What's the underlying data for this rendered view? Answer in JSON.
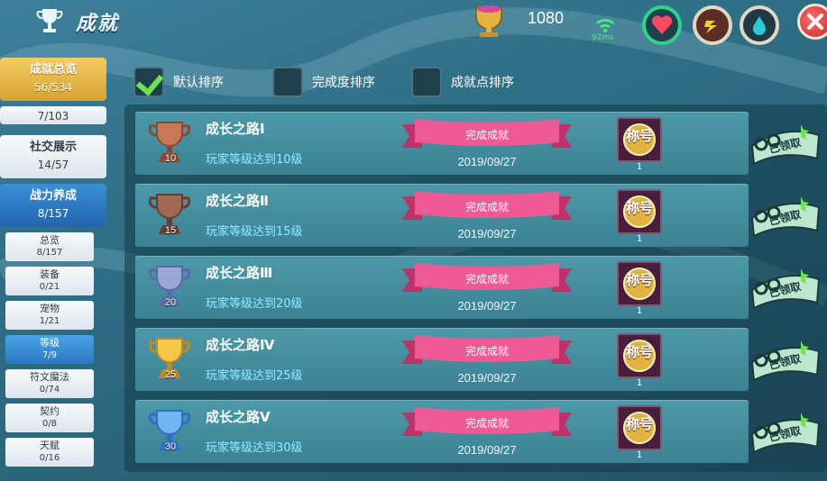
{
  "header": {
    "title": "成就",
    "coins": "1080",
    "ping": "92ms",
    "icons": [
      "trophy-icon",
      "heart-icon",
      "bolt-icon",
      "drop-icon",
      "close-icon"
    ]
  },
  "sidebar": {
    "overview": {
      "label": "成就总览",
      "count": "56/534"
    },
    "partial": {
      "count": "7/103"
    },
    "social": {
      "label": "社交展示",
      "count": "14/57"
    },
    "power": {
      "label": "战力养成",
      "count": "8/157"
    },
    "subs": [
      {
        "label": "总览",
        "count": "8/157"
      },
      {
        "label": "装备",
        "count": "0/21"
      },
      {
        "label": "宠物",
        "count": "1/21"
      },
      {
        "label": "等级",
        "count": "7/9"
      },
      {
        "label": "符文魔法",
        "count": "0/74"
      },
      {
        "label": "契约",
        "count": "0/8"
      },
      {
        "label": "天赋",
        "count": "0/16"
      }
    ]
  },
  "sort": {
    "default": "默认排序",
    "completion": "完成度排序",
    "points": "成就点排序"
  },
  "colors": {
    "accent_gold": "#e2b23f",
    "accent_blue": "#2d78c0",
    "ribbon_pink": "#f05a94",
    "desc_cyan": "#8ff0ff"
  },
  "achievements": [
    {
      "name": "成长之路Ⅰ",
      "level": "10",
      "desc": "玩家等级达到10级",
      "status": "完成成就",
      "date": "2019/09/27",
      "reward": "称号",
      "reward_count": "1",
      "claimed": "已领取",
      "cup": "bronze"
    },
    {
      "name": "成长之路Ⅱ",
      "level": "15",
      "desc": "玩家等级达到15级",
      "status": "完成成就",
      "date": "2019/09/27",
      "reward": "称号",
      "reward_count": "1",
      "claimed": "已领取",
      "cup": "bronze-dark"
    },
    {
      "name": "成长之路Ⅲ",
      "level": "20",
      "desc": "玩家等级达到20级",
      "status": "完成成就",
      "date": "2019/09/27",
      "reward": "称号",
      "reward_count": "1",
      "claimed": "已领取",
      "cup": "silver"
    },
    {
      "name": "成长之路Ⅳ",
      "level": "25",
      "desc": "玩家等级达到25级",
      "status": "完成成就",
      "date": "2019/09/27",
      "reward": "称号",
      "reward_count": "1",
      "claimed": "已领取",
      "cup": "gold"
    },
    {
      "name": "成长之路Ⅴ",
      "level": "30",
      "desc": "玩家等级达到30级",
      "status": "完成成就",
      "date": "2019/09/27",
      "reward": "称号",
      "reward_count": "1",
      "claimed": "已领取",
      "cup": "crystal"
    }
  ]
}
